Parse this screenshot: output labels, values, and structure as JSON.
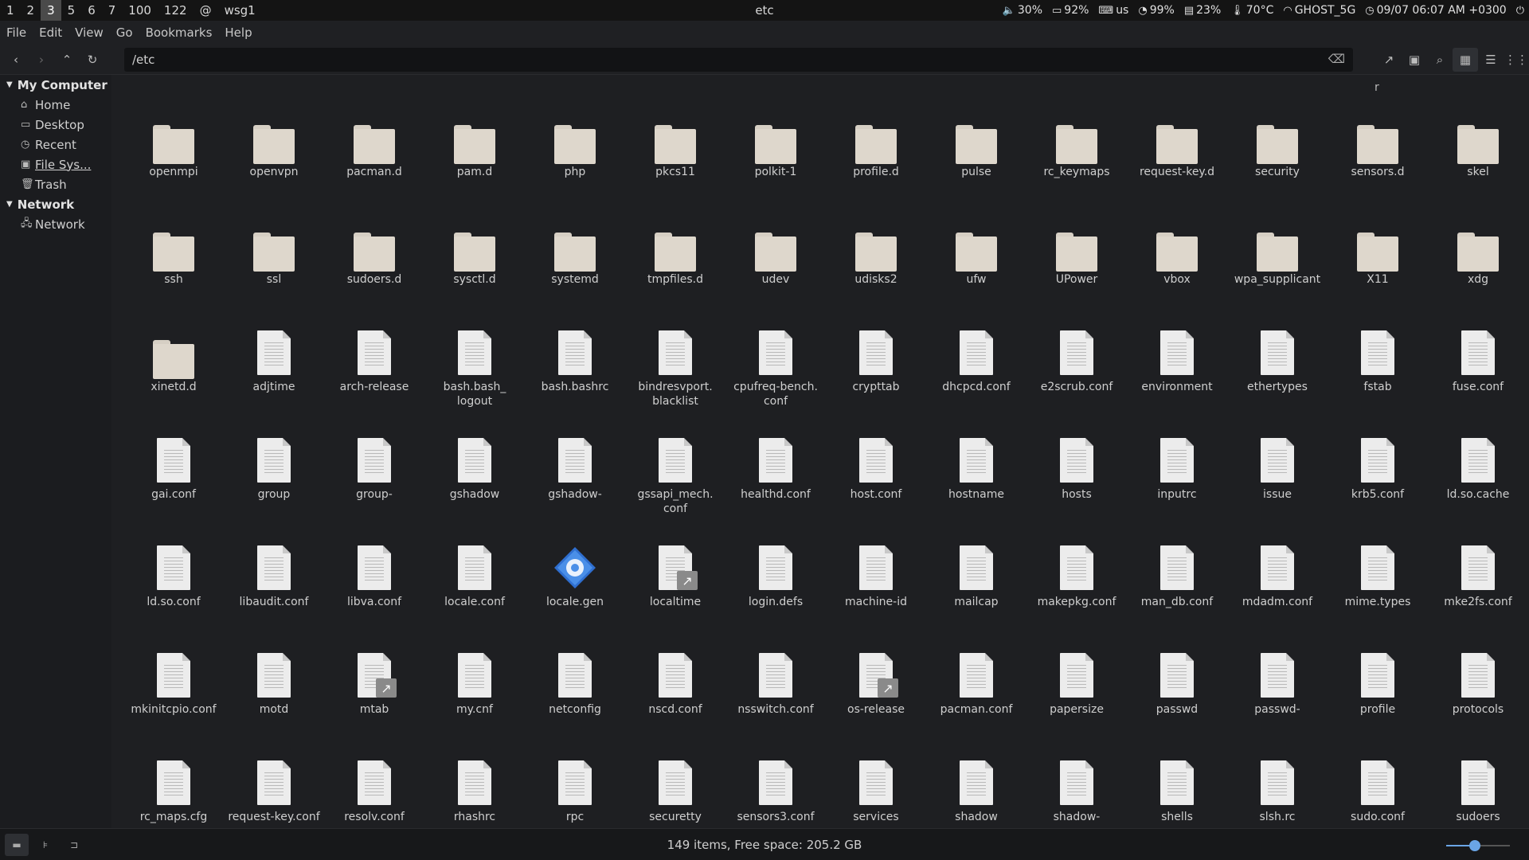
{
  "topbar": {
    "workspaces": [
      {
        "label": "1",
        "active": false
      },
      {
        "label": "2",
        "active": false
      },
      {
        "label": "3",
        "active": true
      },
      {
        "label": "5",
        "active": false
      },
      {
        "label": "6",
        "active": false
      },
      {
        "label": "7",
        "active": false
      },
      {
        "label": "100",
        "active": false
      },
      {
        "label": "122",
        "active": false
      },
      {
        "label": "@",
        "active": false
      },
      {
        "label": "wsg1",
        "active": false
      }
    ],
    "window_title": "etc",
    "status": {
      "volume": "30%",
      "battery": "92%",
      "keyboard": "us",
      "cpu": "99%",
      "memory": "23%",
      "temperature": "70°C",
      "wifi": "GHOST_5G",
      "datetime": "09/07 06:07 AM +0300"
    }
  },
  "menu": [
    "File",
    "Edit",
    "View",
    "Go",
    "Bookmarks",
    "Help"
  ],
  "location": {
    "path": "/etc"
  },
  "sidebar": {
    "sections": [
      {
        "title": "My Computer",
        "items": [
          "Home",
          "Desktop",
          "Recent",
          "File Sys...",
          "Trash"
        ]
      },
      {
        "title": "Network",
        "items": [
          "Network"
        ]
      }
    ]
  },
  "cutoff_text": "r",
  "items": [
    {
      "name": "openmpi",
      "type": "folder"
    },
    {
      "name": "openvpn",
      "type": "folder"
    },
    {
      "name": "pacman.d",
      "type": "folder"
    },
    {
      "name": "pam.d",
      "type": "folder"
    },
    {
      "name": "php",
      "type": "folder"
    },
    {
      "name": "pkcs11",
      "type": "folder"
    },
    {
      "name": "polkit-1",
      "type": "folder"
    },
    {
      "name": "profile.d",
      "type": "folder"
    },
    {
      "name": "pulse",
      "type": "folder"
    },
    {
      "name": "rc_keymaps",
      "type": "folder"
    },
    {
      "name": "request-key.d",
      "type": "folder"
    },
    {
      "name": "security",
      "type": "folder"
    },
    {
      "name": "sensors.d",
      "type": "folder"
    },
    {
      "name": "skel",
      "type": "folder"
    },
    {
      "name": "ssh",
      "type": "folder"
    },
    {
      "name": "ssl",
      "type": "folder"
    },
    {
      "name": "sudoers.d",
      "type": "folder"
    },
    {
      "name": "sysctl.d",
      "type": "folder"
    },
    {
      "name": "systemd",
      "type": "folder"
    },
    {
      "name": "tmpfiles.d",
      "type": "folder"
    },
    {
      "name": "udev",
      "type": "folder"
    },
    {
      "name": "udisks2",
      "type": "folder"
    },
    {
      "name": "ufw",
      "type": "folder"
    },
    {
      "name": "UPower",
      "type": "folder"
    },
    {
      "name": "vbox",
      "type": "folder"
    },
    {
      "name": "wpa_supplicant",
      "type": "folder"
    },
    {
      "name": "X11",
      "type": "folder"
    },
    {
      "name": "xdg",
      "type": "folder"
    },
    {
      "name": "xinetd.d",
      "type": "folder"
    },
    {
      "name": "adjtime",
      "type": "file"
    },
    {
      "name": "arch-release",
      "type": "file"
    },
    {
      "name": "bash.bash_\nlogout",
      "type": "file"
    },
    {
      "name": "bash.bashrc",
      "type": "file"
    },
    {
      "name": "bindresvport.\nblacklist",
      "type": "file"
    },
    {
      "name": "cpufreq-bench.\nconf",
      "type": "file"
    },
    {
      "name": "crypttab",
      "type": "file"
    },
    {
      "name": "dhcpcd.conf",
      "type": "file"
    },
    {
      "name": "e2scrub.conf",
      "type": "file"
    },
    {
      "name": "environment",
      "type": "file"
    },
    {
      "name": "ethertypes",
      "type": "file"
    },
    {
      "name": "fstab",
      "type": "file"
    },
    {
      "name": "fuse.conf",
      "type": "file"
    },
    {
      "name": "gai.conf",
      "type": "file"
    },
    {
      "name": "group",
      "type": "file"
    },
    {
      "name": "group-",
      "type": "file"
    },
    {
      "name": "gshadow",
      "type": "file"
    },
    {
      "name": "gshadow-",
      "type": "file"
    },
    {
      "name": "gssapi_mech.\nconf",
      "type": "file"
    },
    {
      "name": "healthd.conf",
      "type": "file"
    },
    {
      "name": "host.conf",
      "type": "file"
    },
    {
      "name": "hostname",
      "type": "file"
    },
    {
      "name": "hosts",
      "type": "file"
    },
    {
      "name": "inputrc",
      "type": "file"
    },
    {
      "name": "issue",
      "type": "file"
    },
    {
      "name": "krb5.conf",
      "type": "file"
    },
    {
      "name": "ld.so.cache",
      "type": "file"
    },
    {
      "name": "ld.so.conf",
      "type": "file"
    },
    {
      "name": "libaudit.conf",
      "type": "file"
    },
    {
      "name": "libva.conf",
      "type": "file"
    },
    {
      "name": "locale.conf",
      "type": "file"
    },
    {
      "name": "locale.gen",
      "type": "gear"
    },
    {
      "name": "localtime",
      "type": "link"
    },
    {
      "name": "login.defs",
      "type": "file"
    },
    {
      "name": "machine-id",
      "type": "file"
    },
    {
      "name": "mailcap",
      "type": "file"
    },
    {
      "name": "makepkg.conf",
      "type": "file"
    },
    {
      "name": "man_db.conf",
      "type": "file"
    },
    {
      "name": "mdadm.conf",
      "type": "file"
    },
    {
      "name": "mime.types",
      "type": "file"
    },
    {
      "name": "mke2fs.conf",
      "type": "file"
    },
    {
      "name": "mkinitcpio.conf",
      "type": "file"
    },
    {
      "name": "motd",
      "type": "file"
    },
    {
      "name": "mtab",
      "type": "link"
    },
    {
      "name": "my.cnf",
      "type": "file"
    },
    {
      "name": "netconfig",
      "type": "file"
    },
    {
      "name": "nscd.conf",
      "type": "file"
    },
    {
      "name": "nsswitch.conf",
      "type": "file"
    },
    {
      "name": "os-release",
      "type": "link"
    },
    {
      "name": "pacman.conf",
      "type": "file"
    },
    {
      "name": "papersize",
      "type": "file"
    },
    {
      "name": "passwd",
      "type": "file"
    },
    {
      "name": "passwd-",
      "type": "file"
    },
    {
      "name": "profile",
      "type": "file"
    },
    {
      "name": "protocols",
      "type": "file"
    },
    {
      "name": "rc_maps.cfg",
      "type": "file"
    },
    {
      "name": "request-key.conf",
      "type": "file"
    },
    {
      "name": "resolv.conf",
      "type": "file"
    },
    {
      "name": "rhashrc",
      "type": "file"
    },
    {
      "name": "rpc",
      "type": "file"
    },
    {
      "name": "securetty",
      "type": "file"
    },
    {
      "name": "sensors3.conf",
      "type": "file"
    },
    {
      "name": "services",
      "type": "file"
    },
    {
      "name": "shadow",
      "type": "file"
    },
    {
      "name": "shadow-",
      "type": "file"
    },
    {
      "name": "shells",
      "type": "file"
    },
    {
      "name": "slsh.rc",
      "type": "file"
    },
    {
      "name": "sudo.conf",
      "type": "file"
    },
    {
      "name": "sudoers",
      "type": "file"
    }
  ],
  "statusbar": {
    "text": "149 items, Free space: 205.2 GB",
    "zoom": 0.45
  },
  "colors": {
    "accent": "#6aa5e6",
    "folder": "#ded7cc",
    "file": "#ececec"
  }
}
